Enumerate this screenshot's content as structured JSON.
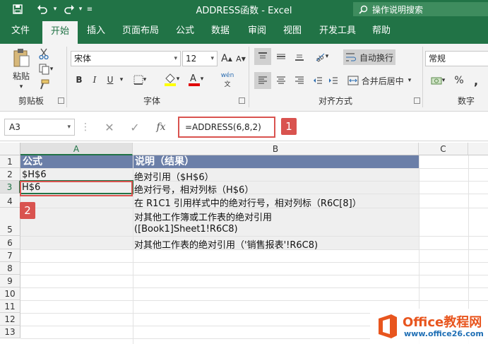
{
  "window": {
    "title": "ADDRESS函数  -  Excel"
  },
  "quick_access": {
    "save": "save",
    "undo": "undo",
    "redo": "redo"
  },
  "search": {
    "placeholder": "操作说明搜索"
  },
  "tabs": [
    {
      "label": "文件"
    },
    {
      "label": "开始"
    },
    {
      "label": "插入"
    },
    {
      "label": "页面布局"
    },
    {
      "label": "公式"
    },
    {
      "label": "数据"
    },
    {
      "label": "审阅"
    },
    {
      "label": "视图"
    },
    {
      "label": "开发工具"
    },
    {
      "label": "帮助"
    }
  ],
  "ribbon": {
    "clipboard": {
      "label": "剪贴板",
      "paste_label": "粘贴"
    },
    "font": {
      "label": "字体",
      "font_name": "宋体",
      "font_size": "12",
      "bold": "B",
      "italic": "I",
      "underline": "U"
    },
    "alignment": {
      "label": "对齐方式",
      "wrap_text": "自动换行",
      "merge_center": "合并后居中"
    },
    "number": {
      "label": "数字",
      "format": "常规",
      "percent": "%",
      "comma": ","
    }
  },
  "formula_bar": {
    "name_box": "A3",
    "fx": "fx",
    "formula": "=ADDRESS(6,8,2)"
  },
  "callouts": {
    "one": "1",
    "two": "2"
  },
  "grid": {
    "columns": [
      "A",
      "B",
      "C"
    ],
    "rows": [
      "1",
      "2",
      "3",
      "4",
      "5",
      "6",
      "7",
      "8",
      "9",
      "10",
      "11",
      "12",
      "13"
    ],
    "header": {
      "a": "公式",
      "b": "说明（结果）"
    },
    "cells": {
      "a2": "$H$6",
      "b2": "绝对引用（$H$6）",
      "a3": "H$6",
      "b3": "绝对行号，相对列标（H$6）",
      "b4": "在 R1C1 引用样式中的绝对行号，相对列标（R6C[8]）",
      "b5a": "对其他工作簿或工作表的绝对引用",
      "b5b": "([Book1]Sheet1!R6C8)",
      "b6": "对其他工作表的绝对引用（'销售报表'!R6C8)"
    }
  },
  "watermark": {
    "brand": "Office教程网",
    "url": "www.office26.com"
  },
  "colors": {
    "excel_green": "#217346",
    "header_fill": "#6b7fa8",
    "callout_red": "#d9534f"
  }
}
